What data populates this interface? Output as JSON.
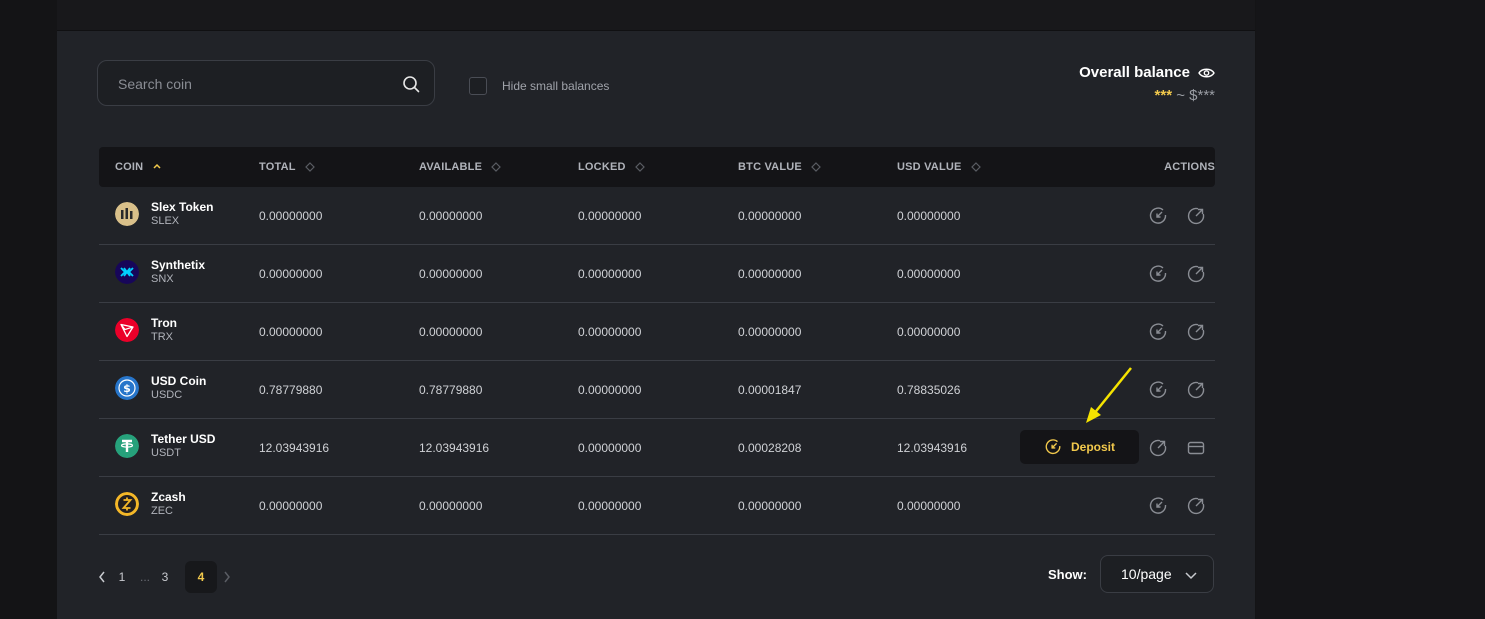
{
  "search": {
    "placeholder": "Search coin"
  },
  "filters": {
    "hide_small_label": "Hide small balances"
  },
  "overall": {
    "title": "Overall balance",
    "stars": "***",
    "rest": " ~ $***"
  },
  "table": {
    "headers": {
      "coin": "COIN",
      "total": "TOTAL",
      "available": "AVAILABLE",
      "locked": "LOCKED",
      "btc": "BTC VALUE",
      "usd": "USD VALUE",
      "actions": "ACTIONS"
    },
    "rows": [
      {
        "name": "Slex Token",
        "symbol": "SLEX",
        "total": "0.00000000",
        "available": "0.00000000",
        "locked": "0.00000000",
        "btc": "0.00000000",
        "usd": "0.00000000"
      },
      {
        "name": "Synthetix",
        "symbol": "SNX",
        "total": "0.00000000",
        "available": "0.00000000",
        "locked": "0.00000000",
        "btc": "0.00000000",
        "usd": "0.00000000"
      },
      {
        "name": "Tron",
        "symbol": "TRX",
        "total": "0.00000000",
        "available": "0.00000000",
        "locked": "0.00000000",
        "btc": "0.00000000",
        "usd": "0.00000000"
      },
      {
        "name": "USD Coin",
        "symbol": "USDC",
        "total": "0.78779880",
        "available": "0.78779880",
        "locked": "0.00000000",
        "btc": "0.00001847",
        "usd": "0.78835026"
      },
      {
        "name": "Tether USD",
        "symbol": "USDT",
        "total": "12.03943916",
        "available": "12.03943916",
        "locked": "0.00000000",
        "btc": "0.00028208",
        "usd": "12.03943916"
      },
      {
        "name": "Zcash",
        "symbol": "ZEC",
        "total": "0.00000000",
        "available": "0.00000000",
        "locked": "0.00000000",
        "btc": "0.00000000",
        "usd": "0.00000000"
      }
    ],
    "deposit_label": "Deposit"
  },
  "pagination": {
    "p1": "1",
    "ellipsis": "...",
    "p3": "3",
    "p4": "4",
    "current": 4
  },
  "page_size": {
    "label": "Show:",
    "value": "10/page"
  },
  "colors": {
    "accent": "#f2c94c",
    "panel": "#212328",
    "background": "#141416"
  },
  "icons": {
    "search": "search-icon",
    "eye": "eye-icon",
    "deposit": "deposit-icon",
    "withdraw": "withdraw-icon",
    "buy": "card-icon"
  }
}
